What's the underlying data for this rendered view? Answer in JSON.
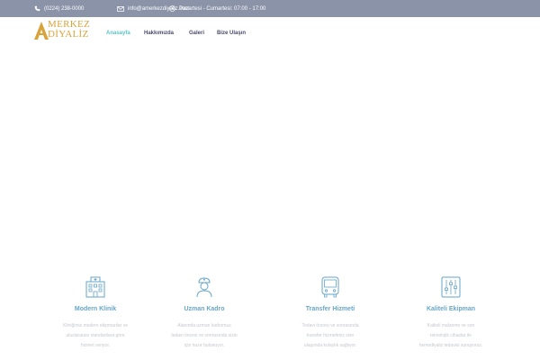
{
  "topbar": {
    "phone": "(0224) 238-0000",
    "email": "info@amerkezdiyaliz.com",
    "hours": "Pazartesi - Cumartesi: 07:00 - 17:00"
  },
  "logo": {
    "line1": "MERKEZ",
    "line2": "DİYALİZ"
  },
  "nav": [
    {
      "label": "Anasayfa"
    },
    {
      "label": "Hakkımızda"
    },
    {
      "label": "Galeri"
    },
    {
      "label": "Bize Ulaşın"
    }
  ],
  "features": [
    {
      "icon": "building-icon",
      "title": "Modern Klinik",
      "lines": [
        "Kliniğimiz modern ekipmanlar ve",
        "uluslararası standartlara göre",
        "hizmet veriyor."
      ]
    },
    {
      "icon": "nurse-icon",
      "title": "Uzman Kadro",
      "lines": [
        "Alanında uzman kadromuz",
        "tedavi öncesi ve sonrasında sizin",
        "için hazır bulunuyor."
      ]
    },
    {
      "icon": "bus-icon",
      "title": "Transfer Hizmeti",
      "lines": [
        "Tedavi öncesi ve sonrasında",
        "transfer hizmetimiz size",
        "ulaşımda kolaylık sağlıyor."
      ]
    },
    {
      "icon": "equalizer-icon",
      "title": "Kaliteli Ekipman",
      "lines": [
        "Kaliteli malzeme ve son",
        "teknolojik cihazlar ile",
        "hemodiyaliz tedavisi sunuyoruz."
      ]
    }
  ],
  "colors": {
    "topbar": "#8a93a8",
    "accent": "#5cc3c8",
    "logo": "#d9a33a",
    "feature_title": "#66a6c9"
  }
}
